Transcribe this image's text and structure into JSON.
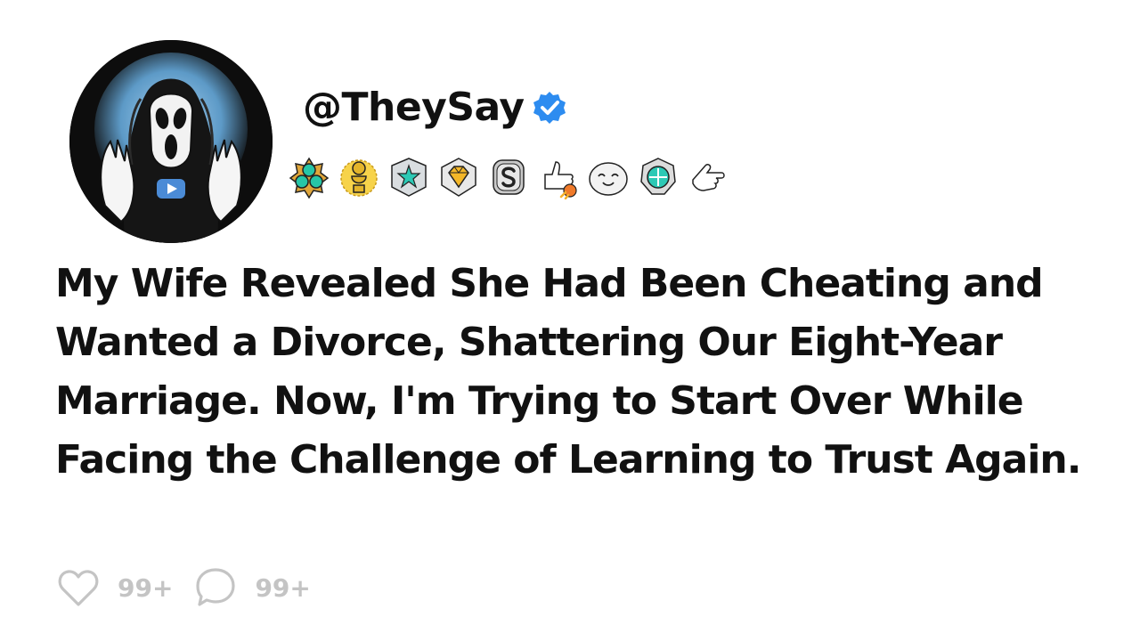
{
  "post": {
    "username": "@TheySay",
    "title": "My Wife Revealed She Had Been Cheating and Wanted a Divorce, Shattering Our Eight-Year Marriage. Now, I'm Trying to Start Over While Facing the Challenge of Learning to Trust Again.",
    "likes": "99+",
    "comments": "99+"
  },
  "icons": {
    "avatar": "ghostface-avatar",
    "verified": "verified-check-icon",
    "like": "heart-outline-icon",
    "comment": "speech-bubble-outline-icon",
    "badges": [
      "gem-cluster-award-icon",
      "gold-trophy-award-icon",
      "star-shield-award-icon",
      "diamond-award-icon",
      "silver-s-award-icon",
      "rocket-thumbs-up-award-icon",
      "smiling-face-award-icon",
      "compass-gem-award-icon",
      "pointing-hand-award-icon"
    ]
  },
  "colors": {
    "background": "#ffffff",
    "text": "#111111",
    "verified": "#2d8cf0",
    "muted": "#c4c4c4",
    "avatar_bg": "#0d0d0d"
  }
}
